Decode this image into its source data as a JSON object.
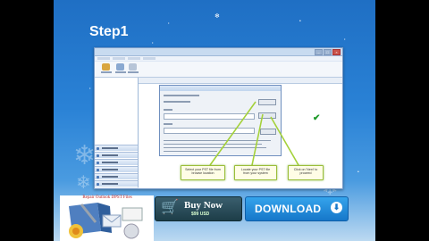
{
  "slide": {
    "title": "Step1"
  },
  "callouts": {
    "select_pst": "Select your PST file from browse location",
    "locate_update": "Locate your PST file from your system",
    "click_next": "Click on 'Next' to proceed"
  },
  "banner": {
    "heading": "Repair Outlook DPST Files",
    "buy_label": "Buy Now",
    "buy_price": "$99 USD",
    "download_label": "DOWNLOAD"
  },
  "icons": {
    "checkmark": "green-check-icon",
    "cart": "shopping-cart-icon",
    "download_arrow": "download-arrow-icon"
  },
  "colors": {
    "slide_background": "#2a82d6",
    "callout_border": "#9bbd3a",
    "download_button": "#1677c9",
    "buy_button": "#2a4d5a"
  }
}
